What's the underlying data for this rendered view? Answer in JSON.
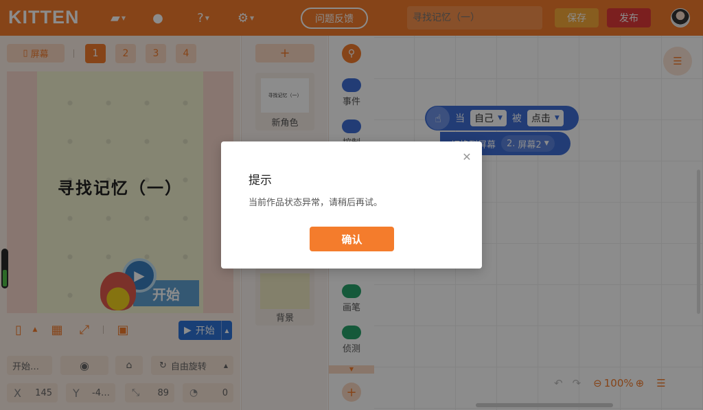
{
  "header": {
    "logo": "KITTEN",
    "icons": [
      "folder-icon",
      "robot-icon",
      "help-icon",
      "settings-icon"
    ],
    "feedback_label": "问题反馈",
    "project_title_placeholder": "寻找记忆（一）",
    "save_label": "保存",
    "publish_label": "发布"
  },
  "stage_panel": {
    "screen_label": "屏幕",
    "pages": [
      "1",
      "2",
      "3",
      "4"
    ],
    "active_page": "1",
    "stage_title": "寻找记忆（一）",
    "start_sign": "开始",
    "run_label": "开始"
  },
  "properties": {
    "name": "开始…",
    "rotation_label": "自由旋转",
    "x_label": "X",
    "x_value": "145",
    "y_label": "Y",
    "y_value": "-4…",
    "size_value": "89",
    "angle_value": "0"
  },
  "sprites": {
    "add_label": "+",
    "sprite_thumb_text": "寻找记忆（一）",
    "sprite_name": "新角色",
    "background_name": "背景"
  },
  "categories": {
    "items": [
      {
        "label": "事件",
        "color": "#3e6ed6"
      },
      {
        "label": "控制",
        "color": "#3e6ed6"
      },
      {
        "label": "画笔",
        "color": "#27a36a"
      },
      {
        "label": "侦测",
        "color": "#27a36a"
      }
    ]
  },
  "workspace": {
    "event_when": "当",
    "event_target": "自己",
    "event_by": "被",
    "event_action": "点击",
    "action_text": "切换到屏幕",
    "action_screen_num": "2.",
    "action_screen_name": "屏幕2",
    "zoom": "100%"
  },
  "modal": {
    "title": "提示",
    "message": "当前作品状态异常，请稍后再试。",
    "confirm_label": "确认"
  },
  "colors": {
    "brand_orange": "#f47c2c",
    "publish_red": "#e13a3a",
    "save_yellow": "#f6a93a",
    "run_blue": "#2f73d8",
    "block_blue": "#3e6ed6"
  }
}
